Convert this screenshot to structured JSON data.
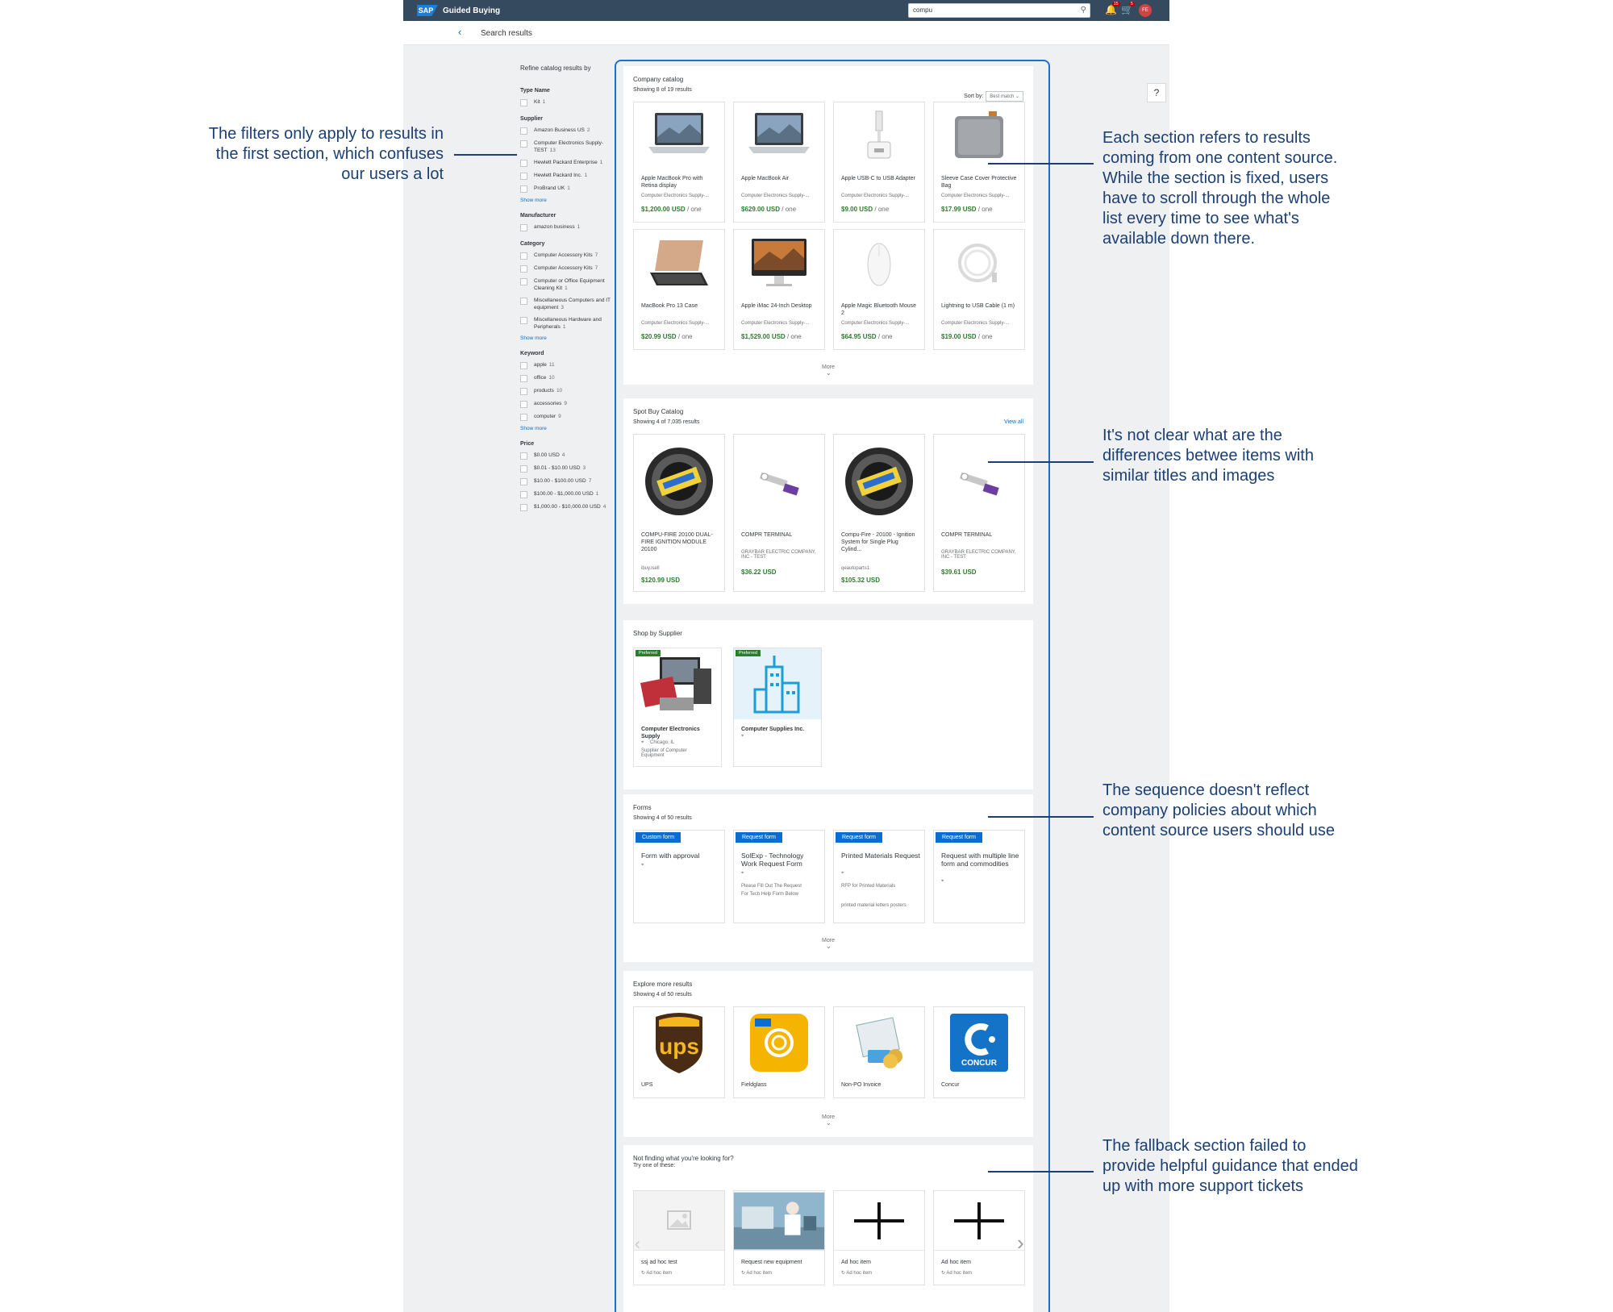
{
  "shell": {
    "logo": "SAP",
    "title": "Guided Buying",
    "search_value": "compu",
    "notif_count": "15",
    "cart_count": "5",
    "avatar": "FE"
  },
  "page": {
    "title": "Search results",
    "help": "?"
  },
  "filters": {
    "title": "Refine catalog results by",
    "groups": [
      {
        "title": "Type Name",
        "options": [
          {
            "label": "Kit",
            "count": "1"
          }
        ]
      },
      {
        "title": "Supplier",
        "options": [
          {
            "label": "Amazon Business US",
            "count": "2"
          },
          {
            "label": "Computer Electronics Supply-TEST",
            "count": "13"
          },
          {
            "label": "Hewlett Packard Enterprise",
            "count": "1"
          },
          {
            "label": "Hewlett Packard Inc.",
            "count": "1"
          },
          {
            "label": "ProBrand UK",
            "count": "1"
          }
        ],
        "more": "Show more"
      },
      {
        "title": "Manufacturer",
        "options": [
          {
            "label": "amazon business",
            "count": "1"
          }
        ]
      },
      {
        "title": "Category",
        "options": [
          {
            "label": "Computer Accessory Kits",
            "count": "7"
          },
          {
            "label": "Computer Accessory Kits",
            "count": "7"
          },
          {
            "label": "Computer or Office Equipment Cleaning Kit",
            "count": "1"
          },
          {
            "label": "Miscellaneous Computers and IT equipment",
            "count": "3"
          },
          {
            "label": "Miscellaneous Hardware and Peripherals",
            "count": "1"
          }
        ],
        "more": "Show more"
      },
      {
        "title": "Keyword",
        "options": [
          {
            "label": "apple",
            "count": "11"
          },
          {
            "label": "office",
            "count": "10"
          },
          {
            "label": "products",
            "count": "10"
          },
          {
            "label": "accessories",
            "count": "9"
          },
          {
            "label": "computer",
            "count": "9"
          }
        ],
        "more": "Show more"
      },
      {
        "title": "Price",
        "options": [
          {
            "label": "$0.00 USD",
            "count": "4"
          },
          {
            "label": "$0.01 - $10.00 USD",
            "count": "3"
          },
          {
            "label": "$10.00 - $100.00 USD",
            "count": "7"
          },
          {
            "label": "$100.00 - $1,000.00 USD",
            "count": "1"
          },
          {
            "label": "$1,000.00 - $10,000.00 USD",
            "count": "4"
          }
        ]
      }
    ]
  },
  "company_catalog": {
    "title": "Company catalog",
    "subtitle": "Showing 8 of 19 results",
    "sort_label": "Sort by:",
    "sort_value": "Best match",
    "more": "More",
    "items": [
      {
        "title": "Apple MacBook Pro with Retina display",
        "supplier": "Computer Electronics Supply-...",
        "price": "$1,200.00 USD",
        "unit": "/ one",
        "icon": "laptop-icon"
      },
      {
        "title": "Apple MacBook Air",
        "supplier": "Computer Electronics Supply-...",
        "price": "$629.00 USD",
        "unit": "/ one",
        "icon": "laptop-icon"
      },
      {
        "title": "Apple USB-C to USB Adapter",
        "supplier": "Computer Electronics Supply-...",
        "price": "$9.00 USD",
        "unit": "/ one",
        "icon": "adapter-icon"
      },
      {
        "title": "Sleeve Case Cover Protective Bag",
        "supplier": "Computer Electronics Supply-...",
        "price": "$17.99 USD",
        "unit": "/ one",
        "icon": "bag-icon"
      },
      {
        "title": "MacBook Pro 13 Case",
        "supplier": "Computer Electronics Supply-...",
        "price": "$20.99 USD",
        "unit": "/ one",
        "icon": "case-icon"
      },
      {
        "title": "Apple iMac 24-Inch Desktop",
        "supplier": "Computer Electronics Supply-...",
        "price": "$1,529.00 USD",
        "unit": "/ one",
        "icon": "monitor-icon"
      },
      {
        "title": "Apple Magic Bluetooth Mouse 2",
        "supplier": "Computer Electronics Supply-...",
        "price": "$64.95 USD",
        "unit": "/ one",
        "icon": "mouse-icon"
      },
      {
        "title": "Lightning to USB Cable (1 m)",
        "supplier": "Computer Electronics Supply-...",
        "price": "$19.00 USD",
        "unit": "/ one",
        "icon": "cable-icon"
      }
    ]
  },
  "spot_buy": {
    "title": "Spot Buy Catalog",
    "subtitle": "Showing 4 of 7,035 results",
    "view_all": "View all",
    "items": [
      {
        "title": "COMPU-FIRE 20100 DUAL-FIRE IGNITION MODULE 20100",
        "supplier": "ibuy.isell",
        "price": "$120.99 USD",
        "icon": "ignition-coil-icon"
      },
      {
        "title": "COMPR TERMINAL",
        "supplier": "GRAYBAR ELECTRIC COMPANY, INC - TEST",
        "price": "$36.22 USD",
        "icon": "terminal-icon"
      },
      {
        "title": "Compu-Fire - 20100 - Ignition System for Single Plug Cylind...",
        "supplier": "qeautoparts1",
        "price": "$105.32 USD",
        "icon": "ignition-coil-icon"
      },
      {
        "title": "COMPR TERMINAL",
        "supplier": "GRAYBAR ELECTRIC COMPANY, INC - TEST",
        "price": "$39.61 USD",
        "icon": "terminal-icon"
      }
    ]
  },
  "shop_by_supplier": {
    "title": "Shop by Supplier",
    "items": [
      {
        "badge": "Preferred",
        "name": "Computer Electronics Supply",
        "location": "Chicago, IL",
        "desc": "Supplier of Computer Equipment",
        "icon": "electronics-icon"
      },
      {
        "badge": "Preferred",
        "name": "Computer Supplies Inc.",
        "location": "",
        "desc": "",
        "icon": "building-icon"
      }
    ]
  },
  "forms": {
    "title": "Forms",
    "subtitle": "Showing 4 of 50 results",
    "more": "More",
    "items": [
      {
        "badge": "Custom form",
        "title": "Form with approval",
        "desc": "",
        "tags": ""
      },
      {
        "badge": "Request form",
        "title": "SolExp - Technology Work Request Form",
        "desc": "Please Fill Out The Request For Tech Help Form Below",
        "tags": ""
      },
      {
        "badge": "Request form",
        "title": "Printed Materials Request",
        "desc": "RFP for Printed Materials",
        "tags": "printed material letters posters"
      },
      {
        "badge": "Request form",
        "title": "Request with multiple line form and commodities",
        "desc": "",
        "tags": ""
      }
    ]
  },
  "explore": {
    "title": "Explore more results",
    "subtitle": "Showing 4 of 50 results",
    "more": "More",
    "items": [
      {
        "label": "UPS",
        "logo": "UPS",
        "icon": "ups-logo-icon"
      },
      {
        "label": "Fieldglass",
        "logo": "SAP Fieldglass",
        "icon": "fieldglass-logo-icon"
      },
      {
        "label": "Non-PO Invoice",
        "logo": "",
        "icon": "invoice-icon"
      },
      {
        "label": "Concur",
        "logo": "CONCUR",
        "icon": "concur-logo-icon"
      }
    ]
  },
  "fallback": {
    "title": "Not finding what you're looking for?",
    "subtitle": "Try one of these:",
    "items": [
      {
        "label": "ssj ad hoc test",
        "sub": "Ad hoc item",
        "icon": "image-placeholder-icon"
      },
      {
        "label": "Request new equipment",
        "sub": "Ad hoc item",
        "icon": "lab-photo-icon"
      },
      {
        "label": "Ad hoc item",
        "sub": "Ad hoc item",
        "icon": "plus-icon"
      },
      {
        "label": "Ad hoc item",
        "sub": "Ad hoc item",
        "icon": "plus-icon"
      }
    ]
  },
  "annotations": {
    "filters": [
      "The filters only apply to results in",
      "the first section, which confuses",
      "our users a lot"
    ],
    "sections": [
      "Each section refers to results",
      "coming from one content source.",
      "While the section is fixed, users",
      "have to scroll through the whole",
      "list every time to see what's",
      "available down there."
    ],
    "similar": [
      "It's not clear what are the",
      "differences betwee items with",
      "similar titles and images"
    ],
    "sequence": [
      "The sequence doesn't reflect",
      "company policies about which",
      "content source users should use"
    ],
    "fallback": [
      "The fallback section failed to",
      "provide helpful guidance that ended",
      "up with more support tickets"
    ]
  },
  "colors": {
    "shell": "#354a5f",
    "link": "#0a6ed1",
    "price": "#2b7d2b",
    "annotation": "#1c3f74",
    "frame": "#1f6fd1"
  }
}
